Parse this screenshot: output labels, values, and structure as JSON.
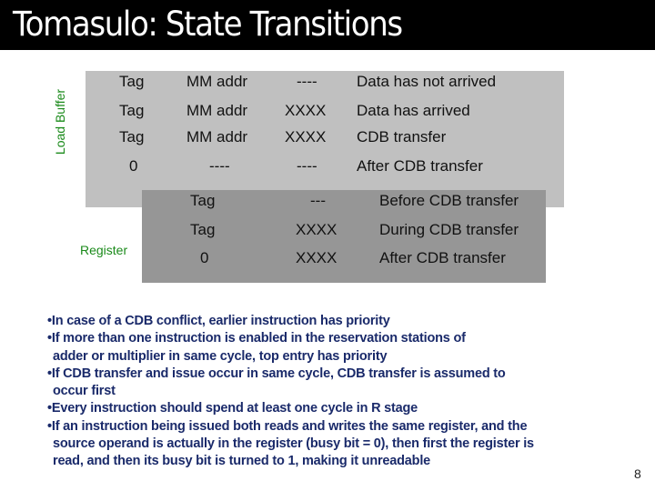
{
  "slide": {
    "title": "Tomasulo: State Transitions",
    "page_number": "8"
  },
  "load_buffer": {
    "label": "Load Buffer",
    "rows": [
      {
        "tag": "Tag",
        "address": "MM addr",
        "data": "----",
        "state": "Data has not arrived"
      },
      {
        "tag": "Tag",
        "address": "MM addr",
        "data": "XXXX",
        "state": "Data has arrived"
      },
      {
        "tag": "Tag",
        "address": "MM addr",
        "data": "XXXX",
        "state": "CDB transfer"
      },
      {
        "tag": "0",
        "address": "----",
        "data": "----",
        "state": "After CDB transfer"
      }
    ]
  },
  "register": {
    "label": "Register",
    "rows": [
      {
        "tag": "Tag",
        "data": "---",
        "state": "Before CDB transfer"
      },
      {
        "tag": "Tag",
        "data": "XXXX",
        "state": "During CDB transfer"
      },
      {
        "tag": "0",
        "data": "XXXX",
        "state": "After CDB transfer"
      }
    ]
  },
  "notes": [
    {
      "lines": [
        "•In case of a CDB conflict, earlier instruction has priority"
      ]
    },
    {
      "lines": [
        "•If more than one instruction is enabled in the reservation stations of",
        "adder or multiplier in same cycle, top entry has priority"
      ]
    },
    {
      "lines": [
        "•If CDB transfer and issue occur in same cycle, CDB transfer is assumed to",
        "occur first"
      ]
    },
    {
      "lines": [
        "•Every instruction should spend at least one cycle in R stage"
      ]
    },
    {
      "lines": [
        "•If an instruction being issued both reads and writes the same register, and the",
        "source operand is actually in the register (busy bit = 0), then first the register is",
        "read, and then its busy bit is turned to 1, making it unreadable"
      ]
    }
  ],
  "colors": {
    "title_bg": "#000000",
    "title_text": "#ffffff",
    "load_box": "#c0c0c0",
    "register_box": "#969696",
    "side_label": "#1a8a1a",
    "notes_text": "#1a2a6a"
  }
}
